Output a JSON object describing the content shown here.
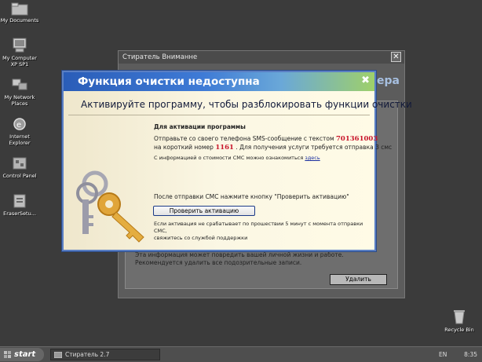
{
  "desktop": {
    "icons": [
      {
        "label": "My Documents",
        "icon": "folder-icon"
      },
      {
        "label": "My Computer\nXP SP1",
        "icon": "computer-icon"
      },
      {
        "label": "My Network\nPlaces",
        "icon": "network-icon"
      },
      {
        "label": "Internet\nExplorer",
        "icon": "internet-explorer-icon"
      },
      {
        "label": "Control Panel",
        "icon": "control-panel-icon"
      },
      {
        "label": "EraserSetu...",
        "icon": "installer-icon"
      },
      {
        "label": "Recycle Bin",
        "icon": "recycle-bin-icon"
      }
    ]
  },
  "background_window": {
    "title": "Стиратель Вниманне",
    "behind_title_fragment": "ера",
    "info_text": "Эта информация может повредить вашей личной жизни и работе. Рекомендуется удалить все подозрительные записи.",
    "delete_button": "Удалить"
  },
  "dialog": {
    "title": "Функция очистки недоступна",
    "close_symbol": "✖",
    "subtitle": "Активируйте программу, чтобы разблокировать функции очистки",
    "activation_heading": "Для активации программы",
    "sms_line1_prefix": "Отправьте со своего телефона SMS-сообщение с текстом",
    "sms_code": "701361003",
    "sms_line2_prefix": "на короткий номер",
    "short_number": "1161",
    "sms_line2_suffix": ". Для получения услуги требуется отправка 3 смс",
    "cost_info_prefix": "С информацией о стоимости СМС можно ознакомиться",
    "cost_info_link": "здесь",
    "after_sms_text": "После отправки СМС нажмите кнопку \"Проверить активацию\"",
    "check_button": "Проверить активацию",
    "if_not_working": "Если активация не срабатывает по прошествии 5 минут с момента отправки СМС,\nсвяжитесь со службой поддержки"
  },
  "taskbar": {
    "start_label": "start",
    "task_item": "Стиратель 2.7",
    "language": "EN",
    "time": "8:35"
  },
  "colors": {
    "dialog_header_start": "#2a5db8",
    "dialog_header_end": "#9fd06a",
    "sms_highlight": "#c8142a",
    "desktop_bg": "#3b3b3b"
  }
}
